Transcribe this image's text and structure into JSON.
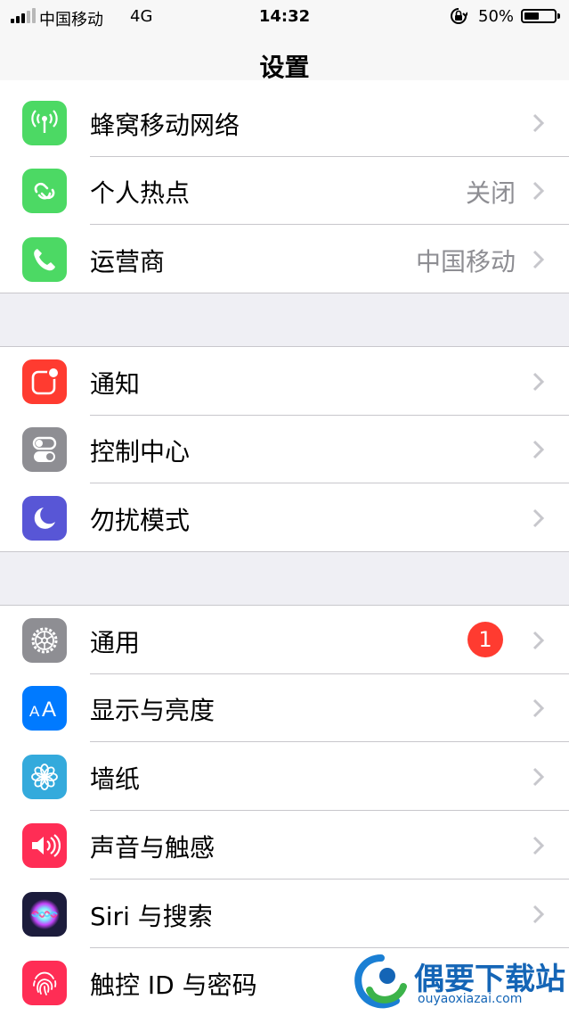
{
  "status_bar": {
    "carrier": "中国移动",
    "network": "4G",
    "time": "14:32",
    "battery_percent": "50%",
    "battery_level": 0.5
  },
  "nav": {
    "title": "设置"
  },
  "groups": [
    {
      "rows": [
        {
          "label": "蜂窝移动网络",
          "value": "",
          "icon": "antenna-icon",
          "color": "#4cd964"
        },
        {
          "label": "个人热点",
          "value": "关闭",
          "icon": "hotspot-icon",
          "color": "#4cd964"
        },
        {
          "label": "运营商",
          "value": "中国移动",
          "icon": "phone-icon",
          "color": "#4cd964"
        }
      ]
    },
    {
      "rows": [
        {
          "label": "通知",
          "value": "",
          "icon": "notification-icon",
          "color": "#ff3b30"
        },
        {
          "label": "控制中心",
          "value": "",
          "icon": "toggles-icon",
          "color": "#8e8e93"
        },
        {
          "label": "勿扰模式",
          "value": "",
          "icon": "moon-icon",
          "color": "#5856d6"
        }
      ]
    },
    {
      "rows": [
        {
          "label": "通用",
          "value": "",
          "badge": "1",
          "icon": "gear-icon",
          "color": "#8e8e93"
        },
        {
          "label": "显示与亮度",
          "value": "",
          "icon": "text-size-icon",
          "color": "#007aff"
        },
        {
          "label": "墙纸",
          "value": "",
          "icon": "flower-icon",
          "color": "#34aadc"
        },
        {
          "label": "声音与触感",
          "value": "",
          "icon": "speaker-icon",
          "color": "#ff2d55"
        },
        {
          "label": "Siri 与搜索",
          "value": "",
          "icon": "siri-icon",
          "color": "#1c1c3c"
        },
        {
          "label": "触控 ID 与密码",
          "value": "",
          "icon": "fingerprint-icon",
          "color": "#ff2d55"
        }
      ]
    }
  ],
  "watermark": {
    "brand": "偶要下载站",
    "url": "ouyaoxiazai.com"
  }
}
